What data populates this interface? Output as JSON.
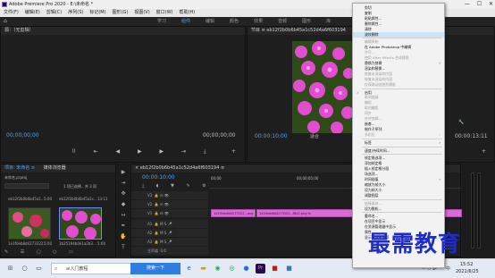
{
  "window": {
    "title": "Adobe Premiere Pro 2020 - E:\\未命名 *",
    "controls": [
      "—",
      "☐",
      "✕"
    ]
  },
  "menubar": [
    "文件(F)",
    "编辑(E)",
    "剪辑(C)",
    "序列(S)",
    "标记(M)",
    "图形(G)",
    "视图(V)",
    "窗口(W)",
    "帮助(H)"
  ],
  "workspaces": [
    "学习",
    "组件",
    "编辑",
    "颜色",
    "效果",
    "音频",
    "图形",
    "库"
  ],
  "source_monitor": {
    "header": "源：（无剪辑）",
    "timecode_left": "00;00;00;00",
    "timecode_right": "00;00;00;00"
  },
  "program_monitor": {
    "header": "节目 ≡ eb12f2b0b6b45a1c52d4a6f603194",
    "timecode": "00:00:10:00",
    "fit": "适合",
    "quality": "完整",
    "duration": "00:00:13:11"
  },
  "project_panel": {
    "tabs": [
      "项目: 未命名 ≡",
      "媒体浏览器"
    ],
    "project_file": "未命名.prproj",
    "count": "1 项已选择，共 3 项",
    "items": [
      {
        "name": "eb12f2b0b6b45a1...",
        "duration": "5:00"
      },
      {
        "name": "eb12f2b0b6b45a1c...",
        "duration": "13:11"
      },
      {
        "name": "1e1f0eb8d4273322...",
        "duration": "5:00"
      },
      {
        "name": "1b25194b0e1a2b3...",
        "duration": "5:00"
      }
    ]
  },
  "timeline": {
    "header": "× eb12f2b0b6b45a1c52d4a6f603194 ≡",
    "timecode": "00:00:10:00",
    "ruler": [
      "00;00",
      "00;00;05;00",
      "00;00;10;00"
    ],
    "tracks": [
      {
        "name": "V3"
      },
      {
        "name": "V2"
      },
      {
        "name": "V1"
      },
      {
        "name": "A1"
      },
      {
        "name": "A2"
      },
      {
        "name": "A3"
      },
      {
        "name": "主声道",
        "value": "0.0"
      }
    ],
    "clips": [
      {
        "label": "1e1f0eb8d4273322...png"
      },
      {
        "label": "1e1f0eb8d4273322...f8d2.png  fx"
      }
    ]
  },
  "context_menu": {
    "items": [
      {
        "label": "剪切",
        "enabled": true
      },
      {
        "label": "复制",
        "enabled": true
      },
      {
        "label": "粘贴属性...",
        "enabled": true
      },
      {
        "label": "删除属性...",
        "enabled": true
      },
      {
        "label": "清除",
        "enabled": true
      },
      {
        "label": "波纹删除",
        "enabled": true,
        "highlighted": true
      },
      {
        "sep": true
      },
      {
        "label": "编辑原始",
        "enabled": false
      },
      {
        "label": "在 Adobe Photoshop 中编辑",
        "enabled": true
      },
      {
        "label": "许可...",
        "enabled": false
      },
      {
        "label": "使用 After Effects 合成替换",
        "enabled": false
      },
      {
        "label": "替换为剪辑",
        "enabled": true,
        "submenu": true
      },
      {
        "label": "渲染和替换...",
        "enabled": true
      },
      {
        "label": "恢复未渲染的内容",
        "enabled": false
      },
      {
        "label": "恢复未渲染的内容",
        "enabled": false
      },
      {
        "label": "仅获取动态图形模板",
        "enabled": false
      },
      {
        "sep": true
      },
      {
        "label": "启用",
        "enabled": true,
        "checked": true
      },
      {
        "label": "取消链接",
        "enabled": false
      },
      {
        "label": "编组",
        "enabled": false
      },
      {
        "label": "取消编组",
        "enabled": false
      },
      {
        "label": "同步",
        "enabled": false
      },
      {
        "label": "合并剪辑...",
        "enabled": false
      },
      {
        "label": "嵌套...",
        "enabled": true
      },
      {
        "label": "制作子序列",
        "enabled": true
      },
      {
        "label": "多机位",
        "enabled": false,
        "submenu": true
      },
      {
        "sep": true
      },
      {
        "label": "标签",
        "enabled": true,
        "submenu": true
      },
      {
        "sep": true
      },
      {
        "label": "速度/持续时间...",
        "enabled": true
      },
      {
        "sep": true
      },
      {
        "label": "帧定格选项...",
        "enabled": true
      },
      {
        "label": "添加帧定格",
        "enabled": true
      },
      {
        "label": "插入帧定格分段",
        "enabled": true
      },
      {
        "label": "场选项...",
        "enabled": true
      },
      {
        "label": "时间插值",
        "enabled": true,
        "submenu": true
      },
      {
        "label": "缩放为帧大小",
        "enabled": true
      },
      {
        "label": "设为帧大小",
        "enabled": true
      },
      {
        "label": "调整图层",
        "enabled": true
      },
      {
        "sep": true
      },
      {
        "label": "链接媒体...",
        "enabled": false
      },
      {
        "label": "设为脱机...",
        "enabled": true
      },
      {
        "sep": true
      },
      {
        "label": "重命名...",
        "enabled": true
      },
      {
        "label": "在项目中显示",
        "enabled": true
      },
      {
        "label": "在资源管理器中显示",
        "enabled": true
      },
      {
        "label": "属性",
        "enabled": true
      },
      {
        "label": "显示剪辑关键帧",
        "enabled": true,
        "submenu": true
      }
    ]
  },
  "watermark": "最需教育",
  "taskbar": {
    "search_placeholder": "在这里输入你要搜索的内容",
    "search_text": "ai入门教程",
    "search_button": "搜索一下",
    "time": "15:52",
    "date": "2021/6/25",
    "lang": "中"
  }
}
